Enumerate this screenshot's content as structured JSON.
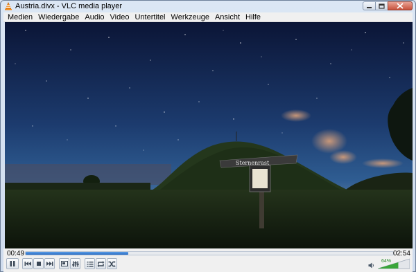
{
  "window": {
    "title": "Austria.divx - VLC media player",
    "controls": [
      "minimize-icon",
      "maximize-icon",
      "close-icon"
    ]
  },
  "menu": {
    "items": [
      "Medien",
      "Wiedergabe",
      "Audio",
      "Video",
      "Untertitel",
      "Werkzeuge",
      "Ansicht",
      "Hilfe"
    ]
  },
  "video": {
    "sign_text": "Sternenrast",
    "scene": "night sky over grassy hill with signpost"
  },
  "playback": {
    "elapsed": "00:49",
    "total": "02:54",
    "progress_fraction": 0.28
  },
  "volume": {
    "label": "64%",
    "fraction": 0.64
  },
  "buttons": {
    "play_pause": "pause-icon",
    "previous": "previous-icon",
    "stop": "stop-icon",
    "next": "next-icon",
    "fullscreen": "fullscreen-icon",
    "extended_settings": "equalizer-icon",
    "playlist": "playlist-icon",
    "loop": "loop-icon",
    "shuffle": "shuffle-icon",
    "mute": "speaker-icon"
  },
  "colors": {
    "accent": "#2a6cc3",
    "volume": "#3aa63a"
  }
}
